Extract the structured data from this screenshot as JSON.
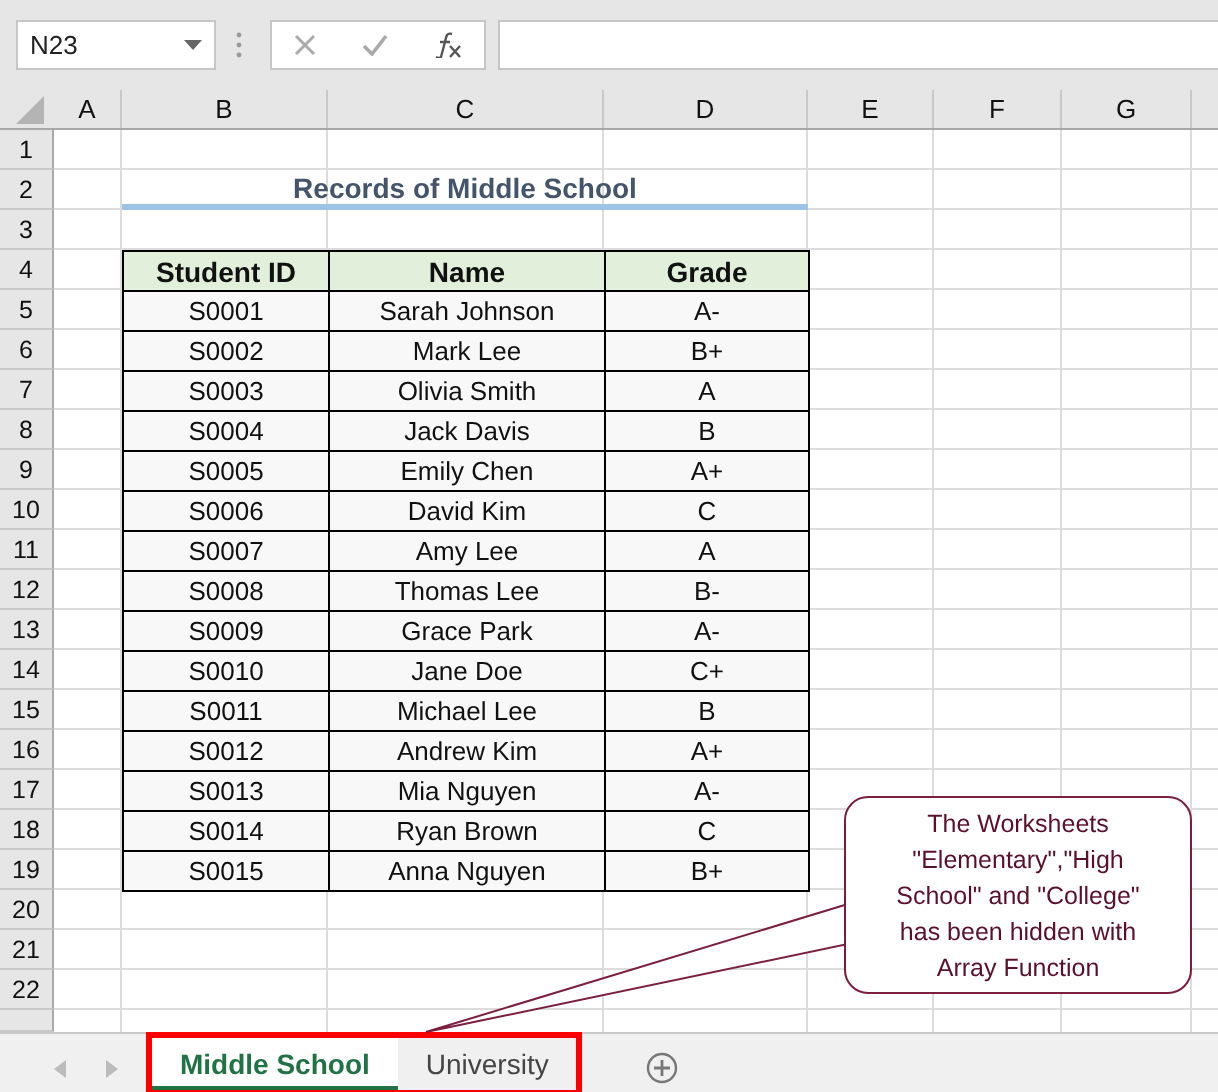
{
  "formula_bar": {
    "name_box": "N23"
  },
  "columns": [
    "A",
    "B",
    "C",
    "D",
    "E",
    "F",
    "G"
  ],
  "rows": [
    "1",
    "2",
    "3",
    "4",
    "5",
    "6",
    "7",
    "8",
    "9",
    "10",
    "11",
    "12",
    "13",
    "14",
    "15",
    "16",
    "17",
    "18",
    "19",
    "20",
    "21",
    "22"
  ],
  "title": "Records of Middle School",
  "table": {
    "columns": [
      "Student ID",
      "Name",
      "Grade"
    ],
    "rows": [
      [
        "S0001",
        "Sarah Johnson",
        "A-"
      ],
      [
        "S0002",
        "Mark Lee",
        "B+"
      ],
      [
        "S0003",
        "Olivia Smith",
        "A"
      ],
      [
        "S0004",
        "Jack Davis",
        "B"
      ],
      [
        "S0005",
        "Emily Chen",
        "A+"
      ],
      [
        "S0006",
        "David Kim",
        "C"
      ],
      [
        "S0007",
        "Amy Lee",
        "A"
      ],
      [
        "S0008",
        "Thomas Lee",
        "B-"
      ],
      [
        "S0009",
        "Grace Park",
        "A-"
      ],
      [
        "S0010",
        "Jane Doe",
        "C+"
      ],
      [
        "S0011",
        "Michael Lee",
        "B"
      ],
      [
        "S0012",
        "Andrew Kim",
        "A+"
      ],
      [
        "S0013",
        "Mia Nguyen",
        "A-"
      ],
      [
        "S0014",
        "Ryan Brown",
        "C"
      ],
      [
        "S0015",
        "Anna Nguyen",
        "B+"
      ]
    ]
  },
  "sheet_tabs": [
    {
      "label": "Middle School",
      "selected": true
    },
    {
      "label": "University",
      "selected": false
    }
  ],
  "callout": {
    "text": "The Worksheets \"Elementary\",\"High School\" and \"College\" has been hidden with Array Function"
  }
}
